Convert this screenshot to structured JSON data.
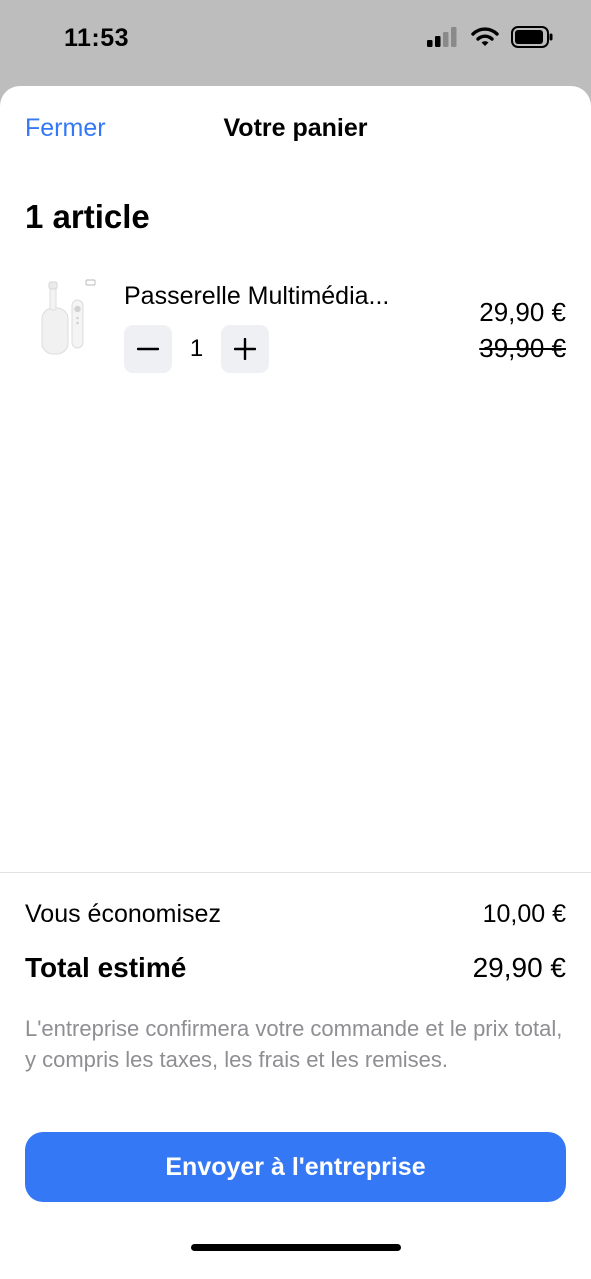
{
  "status_bar": {
    "time": "11:53",
    "icons": [
      "cellular-signal-icon",
      "wifi-icon",
      "battery-icon"
    ]
  },
  "nav": {
    "close_label": "Fermer",
    "title": "Votre panier"
  },
  "cart": {
    "item_count_label": "1 article",
    "items": [
      {
        "name": "Passerelle Multimédia...",
        "quantity": "1",
        "price": "29,90 €",
        "original_price": "39,90 €",
        "thumbnail": "streaming-device-image"
      }
    ]
  },
  "summary": {
    "savings_label": "Vous économisez",
    "savings_value": "10,00 €",
    "total_label": "Total estimé",
    "total_value": "29,90 €",
    "note": "L'entreprise confirmera votre commande et le prix total, y compris les taxes, les frais et les remises."
  },
  "actions": {
    "submit_label": "Envoyer à l'entreprise"
  },
  "colors": {
    "accent": "#3478f6",
    "muted_text": "#8e8e93",
    "backdrop": "#bdbdbd"
  }
}
